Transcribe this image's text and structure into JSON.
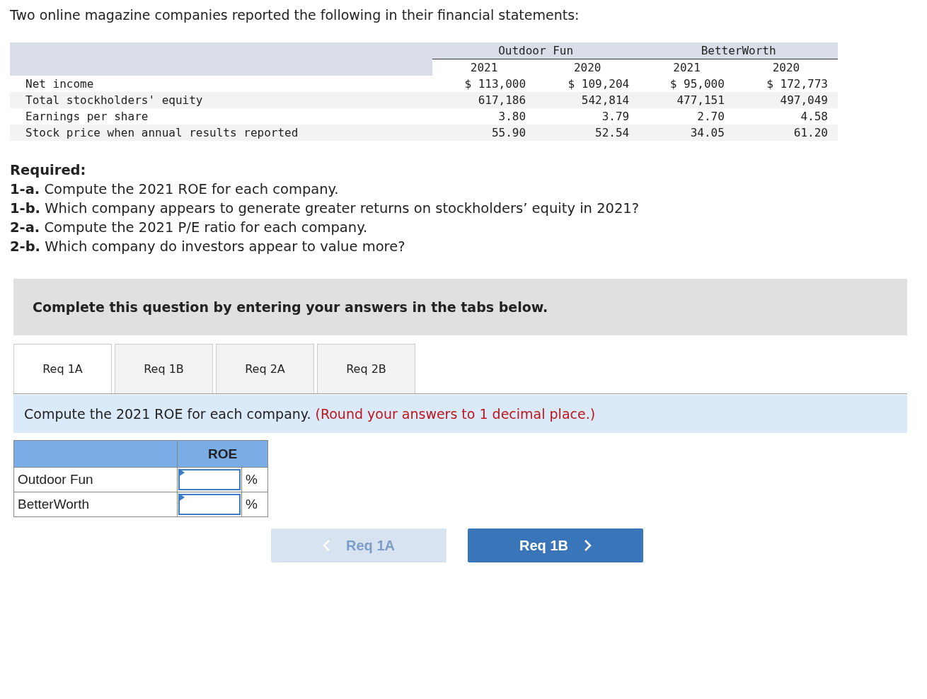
{
  "intro": "Two online magazine companies reported the following in their financial statements:",
  "statements": {
    "companies": [
      {
        "name": "Outdoor Fun",
        "years": [
          "2021",
          "2020"
        ]
      },
      {
        "name": "BetterWorth",
        "years": [
          "2021",
          "2020"
        ]
      }
    ],
    "rows": [
      {
        "label": "Net income",
        "values": [
          "$ 113,000",
          "$ 109,204",
          "$ 95,000",
          "$ 172,773"
        ]
      },
      {
        "label": "Total stockholders' equity",
        "values": [
          "617,186",
          "542,814",
          "477,151",
          "497,049"
        ]
      },
      {
        "label": "Earnings per share",
        "values": [
          "3.80",
          "3.79",
          "2.70",
          "4.58"
        ]
      },
      {
        "label": "Stock price when annual results reported",
        "values": [
          "55.90",
          "52.54",
          "34.05",
          "61.20"
        ]
      }
    ]
  },
  "required": {
    "heading": "Required:",
    "items": [
      "**1-a.** Compute the 2021 ROE for each company.",
      "**1-b.** Which company appears to generate greater returns on stockholders’ equity in 2021?",
      "**2-a.** Compute the 2021 P/E ratio for each company.",
      "**2-b.** Which company do investors appear to value more?"
    ]
  },
  "banner": "Complete this question by entering your answers in the tabs below.",
  "tabs": [
    {
      "label": "Req 1A",
      "selected": true
    },
    {
      "label": "Req 1B",
      "selected": false
    },
    {
      "label": "Req 2A",
      "selected": false
    },
    {
      "label": "Req 2B",
      "selected": false
    }
  ],
  "instruction": {
    "text": "Compute the 2021 ROE for each company.",
    "note": "(Round your answers to 1 decimal place.)"
  },
  "answer_table": {
    "column": "ROE",
    "rows": [
      {
        "label": "Outdoor Fun",
        "unit": "%"
      },
      {
        "label": "BetterWorth",
        "unit": "%"
      }
    ]
  },
  "nav": [
    {
      "label": "Req 1A",
      "kind": "previous",
      "disabled": true
    },
    {
      "label": "Req 1B",
      "kind": "next",
      "disabled": false
    }
  ]
}
